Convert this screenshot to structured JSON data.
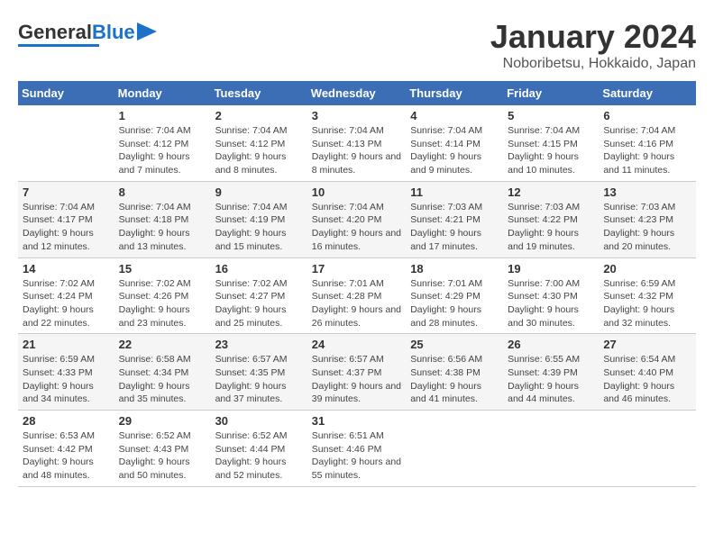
{
  "header": {
    "logo_general": "General",
    "logo_blue": "Blue",
    "title": "January 2024",
    "subtitle": "Noboribetsu, Hokkaido, Japan"
  },
  "calendar": {
    "days_of_week": [
      "Sunday",
      "Monday",
      "Tuesday",
      "Wednesday",
      "Thursday",
      "Friday",
      "Saturday"
    ],
    "weeks": [
      [
        {
          "day": "",
          "sunrise": "",
          "sunset": "",
          "daylight": ""
        },
        {
          "day": "1",
          "sunrise": "Sunrise: 7:04 AM",
          "sunset": "Sunset: 4:12 PM",
          "daylight": "Daylight: 9 hours and 7 minutes."
        },
        {
          "day": "2",
          "sunrise": "Sunrise: 7:04 AM",
          "sunset": "Sunset: 4:12 PM",
          "daylight": "Daylight: 9 hours and 8 minutes."
        },
        {
          "day": "3",
          "sunrise": "Sunrise: 7:04 AM",
          "sunset": "Sunset: 4:13 PM",
          "daylight": "Daylight: 9 hours and 8 minutes."
        },
        {
          "day": "4",
          "sunrise": "Sunrise: 7:04 AM",
          "sunset": "Sunset: 4:14 PM",
          "daylight": "Daylight: 9 hours and 9 minutes."
        },
        {
          "day": "5",
          "sunrise": "Sunrise: 7:04 AM",
          "sunset": "Sunset: 4:15 PM",
          "daylight": "Daylight: 9 hours and 10 minutes."
        },
        {
          "day": "6",
          "sunrise": "Sunrise: 7:04 AM",
          "sunset": "Sunset: 4:16 PM",
          "daylight": "Daylight: 9 hours and 11 minutes."
        }
      ],
      [
        {
          "day": "7",
          "sunrise": "Sunrise: 7:04 AM",
          "sunset": "Sunset: 4:17 PM",
          "daylight": "Daylight: 9 hours and 12 minutes."
        },
        {
          "day": "8",
          "sunrise": "Sunrise: 7:04 AM",
          "sunset": "Sunset: 4:18 PM",
          "daylight": "Daylight: 9 hours and 13 minutes."
        },
        {
          "day": "9",
          "sunrise": "Sunrise: 7:04 AM",
          "sunset": "Sunset: 4:19 PM",
          "daylight": "Daylight: 9 hours and 15 minutes."
        },
        {
          "day": "10",
          "sunrise": "Sunrise: 7:04 AM",
          "sunset": "Sunset: 4:20 PM",
          "daylight": "Daylight: 9 hours and 16 minutes."
        },
        {
          "day": "11",
          "sunrise": "Sunrise: 7:03 AM",
          "sunset": "Sunset: 4:21 PM",
          "daylight": "Daylight: 9 hours and 17 minutes."
        },
        {
          "day": "12",
          "sunrise": "Sunrise: 7:03 AM",
          "sunset": "Sunset: 4:22 PM",
          "daylight": "Daylight: 9 hours and 19 minutes."
        },
        {
          "day": "13",
          "sunrise": "Sunrise: 7:03 AM",
          "sunset": "Sunset: 4:23 PM",
          "daylight": "Daylight: 9 hours and 20 minutes."
        }
      ],
      [
        {
          "day": "14",
          "sunrise": "Sunrise: 7:02 AM",
          "sunset": "Sunset: 4:24 PM",
          "daylight": "Daylight: 9 hours and 22 minutes."
        },
        {
          "day": "15",
          "sunrise": "Sunrise: 7:02 AM",
          "sunset": "Sunset: 4:26 PM",
          "daylight": "Daylight: 9 hours and 23 minutes."
        },
        {
          "day": "16",
          "sunrise": "Sunrise: 7:02 AM",
          "sunset": "Sunset: 4:27 PM",
          "daylight": "Daylight: 9 hours and 25 minutes."
        },
        {
          "day": "17",
          "sunrise": "Sunrise: 7:01 AM",
          "sunset": "Sunset: 4:28 PM",
          "daylight": "Daylight: 9 hours and 26 minutes."
        },
        {
          "day": "18",
          "sunrise": "Sunrise: 7:01 AM",
          "sunset": "Sunset: 4:29 PM",
          "daylight": "Daylight: 9 hours and 28 minutes."
        },
        {
          "day": "19",
          "sunrise": "Sunrise: 7:00 AM",
          "sunset": "Sunset: 4:30 PM",
          "daylight": "Daylight: 9 hours and 30 minutes."
        },
        {
          "day": "20",
          "sunrise": "Sunrise: 6:59 AM",
          "sunset": "Sunset: 4:32 PM",
          "daylight": "Daylight: 9 hours and 32 minutes."
        }
      ],
      [
        {
          "day": "21",
          "sunrise": "Sunrise: 6:59 AM",
          "sunset": "Sunset: 4:33 PM",
          "daylight": "Daylight: 9 hours and 34 minutes."
        },
        {
          "day": "22",
          "sunrise": "Sunrise: 6:58 AM",
          "sunset": "Sunset: 4:34 PM",
          "daylight": "Daylight: 9 hours and 35 minutes."
        },
        {
          "day": "23",
          "sunrise": "Sunrise: 6:57 AM",
          "sunset": "Sunset: 4:35 PM",
          "daylight": "Daylight: 9 hours and 37 minutes."
        },
        {
          "day": "24",
          "sunrise": "Sunrise: 6:57 AM",
          "sunset": "Sunset: 4:37 PM",
          "daylight": "Daylight: 9 hours and 39 minutes."
        },
        {
          "day": "25",
          "sunrise": "Sunrise: 6:56 AM",
          "sunset": "Sunset: 4:38 PM",
          "daylight": "Daylight: 9 hours and 41 minutes."
        },
        {
          "day": "26",
          "sunrise": "Sunrise: 6:55 AM",
          "sunset": "Sunset: 4:39 PM",
          "daylight": "Daylight: 9 hours and 44 minutes."
        },
        {
          "day": "27",
          "sunrise": "Sunrise: 6:54 AM",
          "sunset": "Sunset: 4:40 PM",
          "daylight": "Daylight: 9 hours and 46 minutes."
        }
      ],
      [
        {
          "day": "28",
          "sunrise": "Sunrise: 6:53 AM",
          "sunset": "Sunset: 4:42 PM",
          "daylight": "Daylight: 9 hours and 48 minutes."
        },
        {
          "day": "29",
          "sunrise": "Sunrise: 6:52 AM",
          "sunset": "Sunset: 4:43 PM",
          "daylight": "Daylight: 9 hours and 50 minutes."
        },
        {
          "day": "30",
          "sunrise": "Sunrise: 6:52 AM",
          "sunset": "Sunset: 4:44 PM",
          "daylight": "Daylight: 9 hours and 52 minutes."
        },
        {
          "day": "31",
          "sunrise": "Sunrise: 6:51 AM",
          "sunset": "Sunset: 4:46 PM",
          "daylight": "Daylight: 9 hours and 55 minutes."
        },
        {
          "day": "",
          "sunrise": "",
          "sunset": "",
          "daylight": ""
        },
        {
          "day": "",
          "sunrise": "",
          "sunset": "",
          "daylight": ""
        },
        {
          "day": "",
          "sunrise": "",
          "sunset": "",
          "daylight": ""
        }
      ]
    ]
  }
}
